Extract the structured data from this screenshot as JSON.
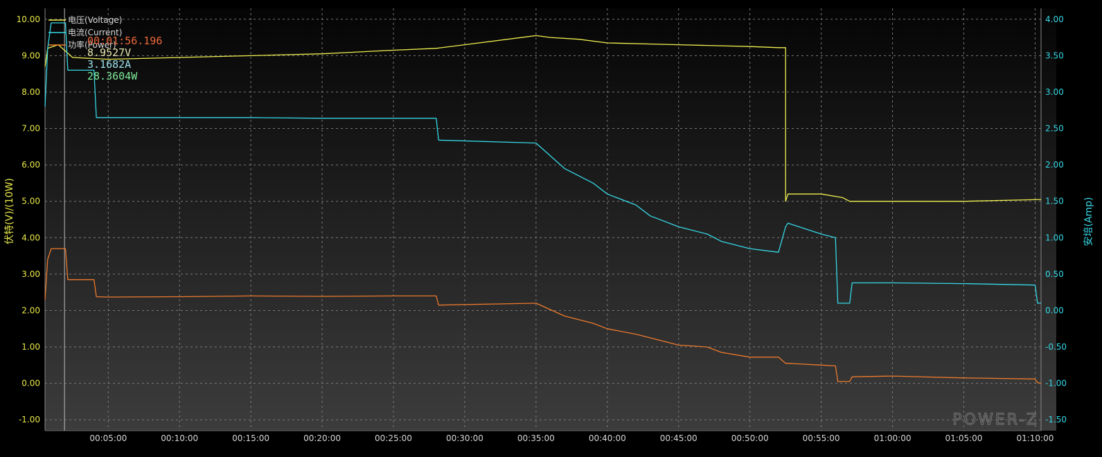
{
  "chart_data": {
    "type": "line",
    "x_unit": "hh:mm:ss",
    "x_range": [
      "00:00:34",
      "01:10:25"
    ],
    "x_ticks": [
      "00:05:00",
      "00:10:00",
      "00:15:00",
      "00:20:00",
      "00:25:00",
      "00:30:00",
      "00:35:00",
      "00:40:00",
      "00:45:00",
      "00:50:00",
      "00:55:00",
      "01:00:00",
      "01:05:00",
      "01:10:00"
    ],
    "y_left": {
      "label": "伏特(V)/(10W)",
      "range": [
        -1.3,
        10.3
      ],
      "ticks": [
        "-1.00",
        "0.00",
        "1.00",
        "2.00",
        "3.00",
        "4.00",
        "5.00",
        "6.00",
        "7.00",
        "8.00",
        "9.00",
        "10.00"
      ],
      "color": "#e8e84a"
    },
    "y_right": {
      "label": "安培(Amp)",
      "range": [
        -1.65,
        4.15
      ],
      "ticks": [
        "-1.50",
        "-1.00",
        "-0.50",
        "0.00",
        "0.50",
        "1.00",
        "1.50",
        "2.00",
        "2.50",
        "3.00",
        "3.50",
        "4.00"
      ],
      "color": "#36d8e6"
    },
    "legend_placement": "top-left",
    "grid": true,
    "series": [
      {
        "name": "电压(Voltage)",
        "axis": "left",
        "color": "#f0ef50",
        "x": [
          "00:00:34",
          "00:00:45",
          "00:01:30",
          "00:02:30",
          "00:05:00",
          "00:10:00",
          "00:15:00",
          "00:20:00",
          "00:25:00",
          "00:28:00",
          "00:30:00",
          "00:35:00",
          "00:36:00",
          "00:38:00",
          "00:40:00",
          "00:45:00",
          "00:50:00",
          "00:52:00",
          "00:52:30",
          "00:52:30",
          "00:52:40",
          "00:55:00",
          "00:56:30",
          "00:57:00",
          "01:00:00",
          "01:05:00",
          "01:10:25"
        ],
        "y": [
          8.7,
          9.2,
          9.3,
          8.95,
          8.9,
          8.95,
          9.0,
          9.05,
          9.15,
          9.2,
          9.3,
          9.55,
          9.5,
          9.45,
          9.35,
          9.3,
          9.25,
          9.22,
          9.22,
          5.0,
          5.2,
          5.2,
          5.1,
          5.0,
          5.0,
          5.0,
          5.05
        ]
      },
      {
        "name": "电流(Current)",
        "axis": "right",
        "color": "#36d8e6",
        "x": [
          "00:00:34",
          "00:00:45",
          "00:01:00",
          "00:02:00",
          "00:02:10",
          "00:04:00",
          "00:04:10",
          "00:05:00",
          "00:10:00",
          "00:15:00",
          "00:20:00",
          "00:25:00",
          "00:28:00",
          "00:28:10",
          "00:35:00",
          "00:37:00",
          "00:39:00",
          "00:40:00",
          "00:42:00",
          "00:43:00",
          "00:45:00",
          "00:47:00",
          "00:48:00",
          "00:50:00",
          "00:52:00",
          "00:52:30",
          "00:52:40",
          "00:55:00",
          "00:56:00",
          "00:56:10",
          "00:57:00",
          "00:57:10",
          "01:00:00",
          "01:05:00",
          "01:10:00",
          "01:10:10",
          "01:10:25"
        ],
        "y": [
          2.8,
          3.6,
          3.95,
          3.95,
          3.3,
          3.3,
          2.65,
          2.65,
          2.65,
          2.65,
          2.64,
          2.64,
          2.64,
          2.34,
          2.3,
          1.95,
          1.75,
          1.6,
          1.45,
          1.3,
          1.15,
          1.05,
          0.95,
          0.85,
          0.8,
          1.15,
          1.2,
          1.05,
          1.0,
          0.1,
          0.1,
          0.38,
          0.38,
          0.37,
          0.35,
          0.1,
          0.1
        ]
      },
      {
        "name": "功率(Power)",
        "axis": "left",
        "color": "#ee7a2c",
        "x": [
          "00:00:34",
          "00:00:45",
          "00:01:00",
          "00:02:00",
          "00:02:10",
          "00:04:00",
          "00:04:10",
          "00:05:00",
          "00:10:00",
          "00:15:00",
          "00:20:00",
          "00:25:00",
          "00:28:00",
          "00:28:10",
          "00:35:00",
          "00:37:00",
          "00:39:00",
          "00:40:00",
          "00:42:00",
          "00:43:00",
          "00:45:00",
          "00:47:00",
          "00:48:00",
          "00:50:00",
          "00:52:00",
          "00:52:30",
          "00:52:40",
          "00:55:00",
          "00:56:00",
          "00:56:10",
          "00:57:00",
          "00:57:10",
          "01:00:00",
          "01:05:00",
          "01:10:00",
          "01:10:10",
          "01:10:25"
        ],
        "y": [
          2.3,
          3.4,
          3.7,
          3.7,
          2.85,
          2.85,
          2.38,
          2.37,
          2.38,
          2.4,
          2.39,
          2.4,
          2.4,
          2.15,
          2.2,
          1.85,
          1.65,
          1.5,
          1.35,
          1.25,
          1.05,
          1.0,
          0.85,
          0.72,
          0.72,
          0.55,
          0.55,
          0.5,
          0.48,
          0.05,
          0.05,
          0.18,
          0.2,
          0.15,
          0.12,
          0.02,
          0.0
        ]
      }
    ],
    "cursor": {
      "time": "00:01:56.196",
      "voltage": "8.9527V",
      "current": "3.1682A",
      "power": "28.3604W"
    }
  },
  "watermark": "POWER-Z"
}
